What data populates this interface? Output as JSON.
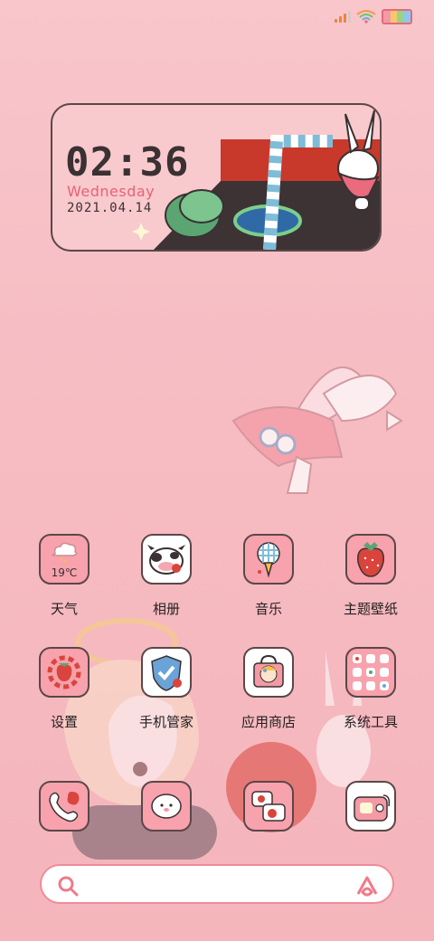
{
  "widget": {
    "time": "02:36",
    "weekday": "Wednesday",
    "date": "2021.04.14"
  },
  "apps": {
    "row1": [
      {
        "label": "天气",
        "icon": "weather-icon",
        "badge": "19℃"
      },
      {
        "label": "相册",
        "icon": "gallery-icon"
      },
      {
        "label": "音乐",
        "icon": "music-icon"
      },
      {
        "label": "主题壁纸",
        "icon": "theme-wallpaper-icon"
      }
    ],
    "row2": [
      {
        "label": "设置",
        "icon": "settings-icon"
      },
      {
        "label": "手机管家",
        "icon": "phone-manager-icon"
      },
      {
        "label": "应用商店",
        "icon": "app-store-icon"
      },
      {
        "label": "系统工具",
        "icon": "system-tools-icon"
      }
    ],
    "dock": [
      {
        "icon": "phone-icon"
      },
      {
        "icon": "contacts-icon"
      },
      {
        "icon": "messages-icon"
      },
      {
        "icon": "camera-icon"
      }
    ]
  },
  "colors": {
    "accent": "#ea6272",
    "background": "#f8c6cb",
    "icon_fill": "#f7a2ad",
    "outline": "#5b4748"
  }
}
